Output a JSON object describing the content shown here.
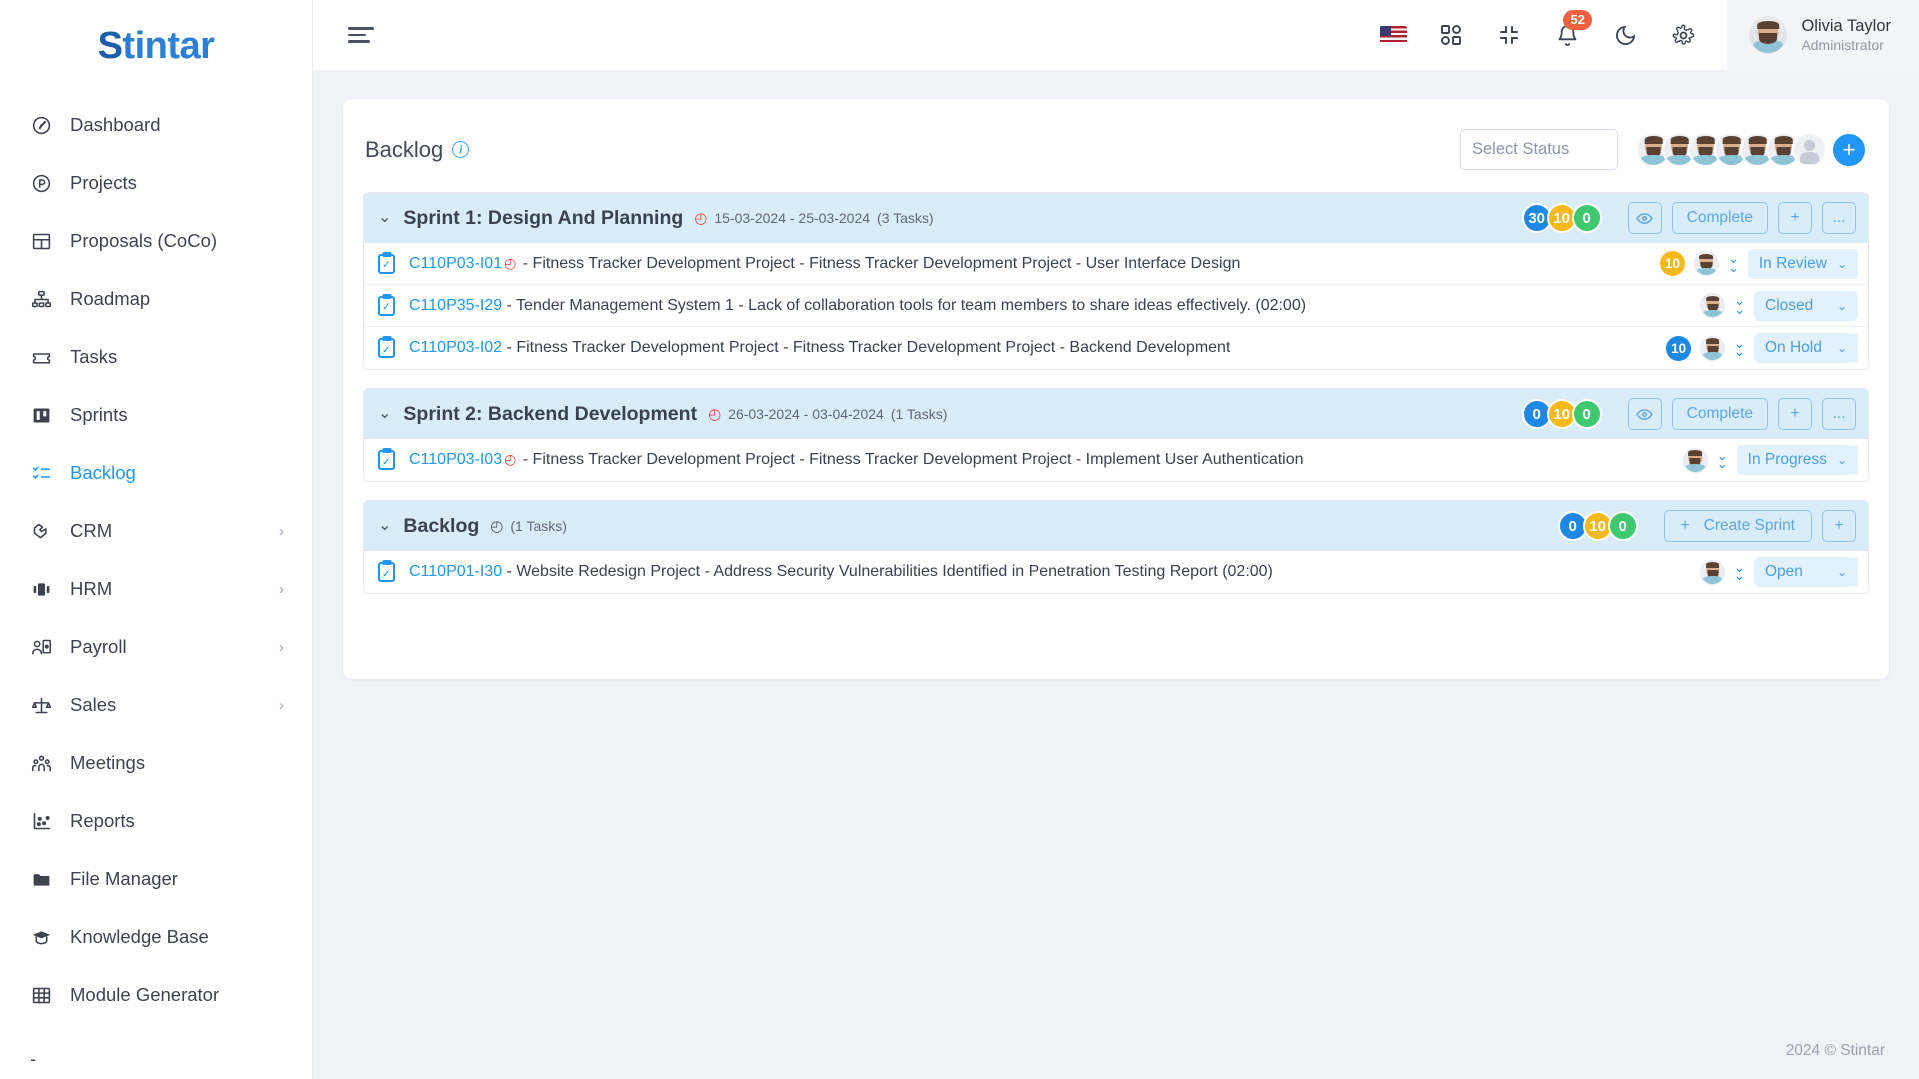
{
  "brand": {
    "prefix": "S",
    "rest": "tintar"
  },
  "sidebar": {
    "items": [
      {
        "label": "Dashboard",
        "icon": "gauge-icon",
        "active": false,
        "hasCaret": false
      },
      {
        "label": "Projects",
        "icon": "circle-p-icon",
        "active": false,
        "hasCaret": false
      },
      {
        "label": "Proposals (CoCo)",
        "icon": "layout-icon",
        "active": false,
        "hasCaret": false
      },
      {
        "label": "Roadmap",
        "icon": "hierarchy-icon",
        "active": false,
        "hasCaret": false
      },
      {
        "label": "Tasks",
        "icon": "ticket-icon",
        "active": false,
        "hasCaret": false
      },
      {
        "label": "Sprints",
        "icon": "board-icon",
        "active": false,
        "hasCaret": false
      },
      {
        "label": "Backlog",
        "icon": "checklist-icon",
        "active": true,
        "hasCaret": false
      },
      {
        "label": "CRM",
        "icon": "handshake-icon",
        "active": false,
        "hasCaret": true
      },
      {
        "label": "HRM",
        "icon": "hrm-icon",
        "active": false,
        "hasCaret": true
      },
      {
        "label": "Payroll",
        "icon": "payroll-icon",
        "active": false,
        "hasCaret": true
      },
      {
        "label": "Sales",
        "icon": "scales-icon",
        "active": false,
        "hasCaret": true
      },
      {
        "label": "Meetings",
        "icon": "people-icon",
        "active": false,
        "hasCaret": false
      },
      {
        "label": "Reports",
        "icon": "scatter-chart-icon",
        "active": false,
        "hasCaret": false
      },
      {
        "label": "File Manager",
        "icon": "folder-icon",
        "active": false,
        "hasCaret": false
      },
      {
        "label": "Knowledge Base",
        "icon": "graduation-cap-icon",
        "active": false,
        "hasCaret": false
      },
      {
        "label": "Module Generator",
        "icon": "grid-table-icon",
        "active": false,
        "hasCaret": false
      }
    ],
    "trailing_dash": "-"
  },
  "topbar": {
    "menu_icon": "hamburger-icon",
    "icons": [
      {
        "name": "language-flag-us",
        "glyph": "flag"
      },
      {
        "name": "apps-grid-icon",
        "glyph": "grid"
      },
      {
        "name": "fullscreen-exit-icon",
        "glyph": "compress"
      },
      {
        "name": "notifications-bell-icon",
        "glyph": "bell",
        "badge": "52"
      },
      {
        "name": "dark-mode-icon",
        "glyph": "moon"
      },
      {
        "name": "settings-gear-icon",
        "glyph": "gear"
      }
    ],
    "notification_count": "52",
    "user": {
      "name": "Olivia Taylor",
      "role": "Administrator"
    }
  },
  "page": {
    "title": "Backlog",
    "info_glyph": "i",
    "select_status_placeholder": "Select Status",
    "member_count": 6,
    "add_member_label": "+"
  },
  "colors": {
    "accent": "#2196f3",
    "group_header_bg": "#d9ecfa",
    "badge_blue": "#1e88e5",
    "badge_yellow": "#f6b91a",
    "badge_green": "#3ec96e",
    "notification_red": "#f2613f",
    "clock_red": "#ef4136",
    "status_pill_bg": "#e3f1fc"
  },
  "groups": [
    {
      "name": "Sprint 1: Design And Planning",
      "clock": "red",
      "dates": "15-03-2024 - 25-03-2024",
      "task_count_label": "(3 Tasks)",
      "counters": [
        "30",
        "10",
        "0"
      ],
      "actions": {
        "eye": "eye-icon",
        "complete": "Complete",
        "plus": "+",
        "more": "..."
      },
      "action_type": "sprint",
      "tasks": [
        {
          "code": "C110P03-I01",
          "has_clock": true,
          "text": " - Fitness Tracker Development Project - Fitness Tracker Development Project - User Interface Design",
          "points": "10",
          "points_color": "#f6b91a",
          "status": "In Review"
        },
        {
          "code": "C110P35-I29",
          "has_clock": false,
          "text": " - Tender Management System 1 - Lack of collaboration tools for team members to share ideas effectively. (02:00)",
          "points": "",
          "points_color": "",
          "status": "Closed"
        },
        {
          "code": "C110P03-I02",
          "has_clock": false,
          "text": " - Fitness Tracker Development Project - Fitness Tracker Development Project - Backend Development",
          "points": "10",
          "points_color": "#1e88e5",
          "status": "On Hold"
        }
      ]
    },
    {
      "name": "Sprint 2: Backend Development",
      "clock": "red",
      "dates": "26-03-2024 - 03-04-2024",
      "task_count_label": "(1 Tasks)",
      "counters": [
        "0",
        "10",
        "0"
      ],
      "actions": {
        "eye": "eye-icon",
        "complete": "Complete",
        "plus": "+",
        "more": "..."
      },
      "action_type": "sprint",
      "tasks": [
        {
          "code": "C110P03-I03",
          "has_clock": true,
          "text": " - Fitness Tracker Development Project - Fitness Tracker Development Project - Implement User Authentication",
          "points": "",
          "points_color": "",
          "status": "In Progress"
        }
      ]
    },
    {
      "name": "Backlog",
      "clock": "gray",
      "dates": "",
      "task_count_label": "(1 Tasks)",
      "counters": [
        "0",
        "10",
        "0"
      ],
      "actions": {
        "create_sprint": "Create Sprint",
        "plus": "+"
      },
      "action_type": "backlog",
      "tasks": [
        {
          "code": "C110P01-I30",
          "has_clock": false,
          "text": " - Website Redesign Project - Address Security Vulnerabilities Identified in Penetration Testing Report (02:00)",
          "points": "",
          "points_color": "",
          "status": "Open"
        }
      ]
    }
  ],
  "footer": {
    "copyright": "2024 © Stintar"
  }
}
